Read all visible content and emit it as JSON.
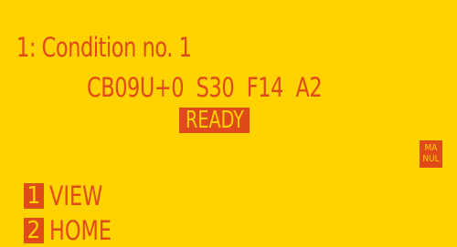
{
  "screen": {
    "title": "1: Condition no. 1",
    "params": "CB09U+0  S30  F14  A2",
    "status": "READY",
    "mode": {
      "line1": "MA",
      "line2": "NUL"
    }
  },
  "menu": [
    {
      "number": "1",
      "label": "VIEW"
    },
    {
      "number": "2",
      "label": "HOME"
    }
  ],
  "colors": {
    "background": "#FFD200",
    "foreground": "#E04A1A"
  }
}
